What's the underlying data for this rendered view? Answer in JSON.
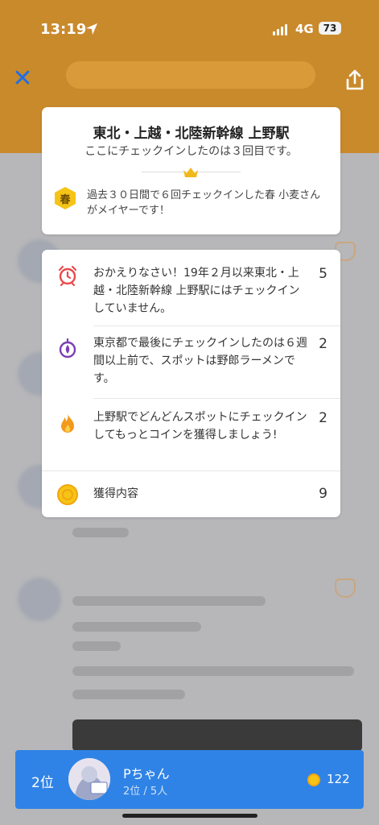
{
  "status_bar": {
    "time": "13:19",
    "network": "4G",
    "battery": "73"
  },
  "venue_card": {
    "title": "東北・上越・北陸新幹線 上野駅",
    "checkin_count_text": "ここにチェックインしたのは３回目です。",
    "mayor_badge": "春",
    "mayor_text": "過去３０日間で６回チェックインした春 小麦さんがメイヤーです！"
  },
  "rewards_card": {
    "items": [
      {
        "icon": "alarm-clock-icon",
        "text": "おかえりなさい！19年２月以来東北・上越・北陸新幹線 上野駅にはチェックインしていません。",
        "coins": "5"
      },
      {
        "icon": "location-pin-icon",
        "text": "東京都で最後にチェックインしたのは６週間以上前で、スポットは野郎ラーメンです。",
        "coins": "2"
      },
      {
        "icon": "flame-icon",
        "text": "上野駅でどんどんスポットにチェックインしてもっとコインを獲得しましょう!",
        "coins": "2"
      }
    ],
    "total_label": "獲得内容",
    "total_coins": "9"
  },
  "rank_bar": {
    "position": "2位",
    "name": "Pちゃん",
    "sub": "2位 / 5人",
    "coins": "122"
  },
  "colors": {
    "accent_blue": "#2f83e6",
    "coin_yellow": "#f6c416",
    "close_blue": "#1f6fe5"
  }
}
